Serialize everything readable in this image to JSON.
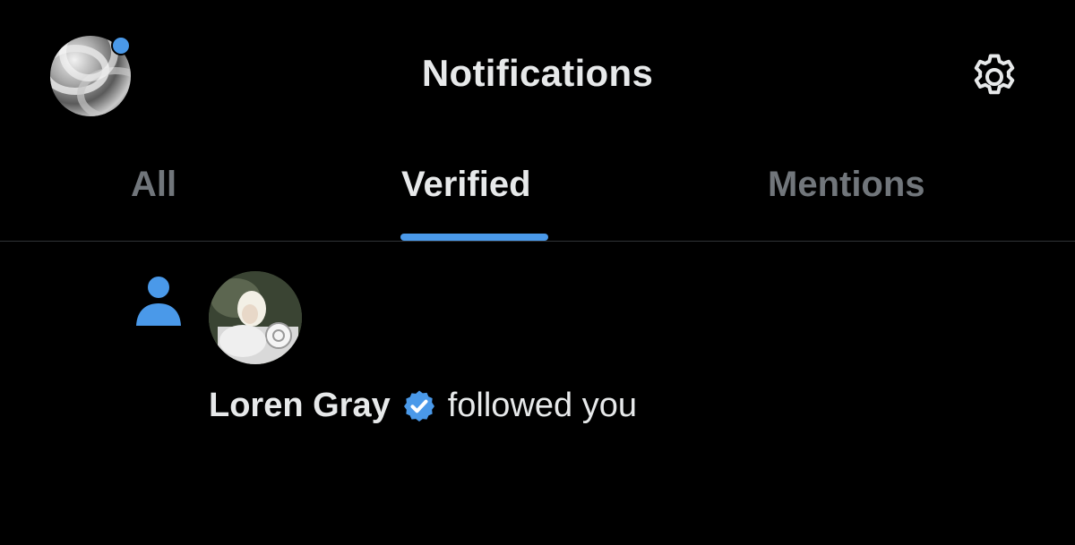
{
  "header": {
    "title": "Notifications",
    "has_unread_dot": true
  },
  "tabs": [
    {
      "label": "All",
      "active": false
    },
    {
      "label": "Verified",
      "active": true
    },
    {
      "label": "Mentions",
      "active": false
    }
  ],
  "notification": {
    "type": "follow",
    "icon": "person-icon",
    "user_name": "Loren Gray",
    "verified": true,
    "action": "followed you"
  },
  "colors": {
    "background": "#000000",
    "accent": "#4a99e9",
    "text_primary": "#e7e9ea",
    "text_secondary": "#71767b",
    "divider": "#2f3336"
  }
}
